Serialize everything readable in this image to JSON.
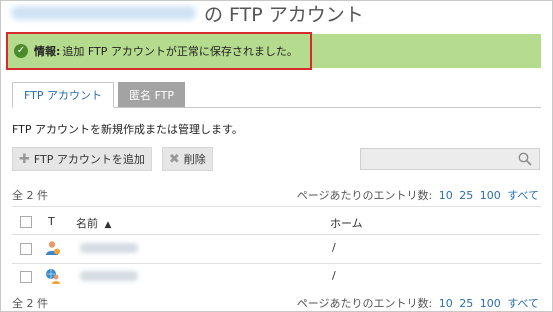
{
  "header": {
    "title_suffix": "の FTP アカウント"
  },
  "notice": {
    "label": "情報:",
    "message": "追加 FTP アカウントが正常に保存されました。"
  },
  "tabs": [
    {
      "label": "FTP アカウント",
      "active": true
    },
    {
      "label": "匿名 FTP",
      "active": false
    }
  ],
  "description": "FTP アカウントを新規作成または管理します。",
  "toolbar": {
    "add_label": "FTP アカウントを追加",
    "delete_label": "削除",
    "search_placeholder": ""
  },
  "list": {
    "total_label": "全 2 件",
    "per_page_label": "ページあたりのエントリ数:",
    "per_page_options": [
      "10",
      "25",
      "100",
      "すべて"
    ],
    "columns": {
      "type": "T",
      "name": "名前",
      "home": "ホーム"
    },
    "sort_indicator": "▲",
    "rows": [
      {
        "home": "/",
        "icon": "user-icon"
      },
      {
        "home": "/",
        "icon": "web-user-icon"
      }
    ]
  },
  "colors": {
    "accent": "#2a6fb0",
    "notice_bg": "#b5dc8e",
    "highlight_border": "#d62b2b"
  }
}
